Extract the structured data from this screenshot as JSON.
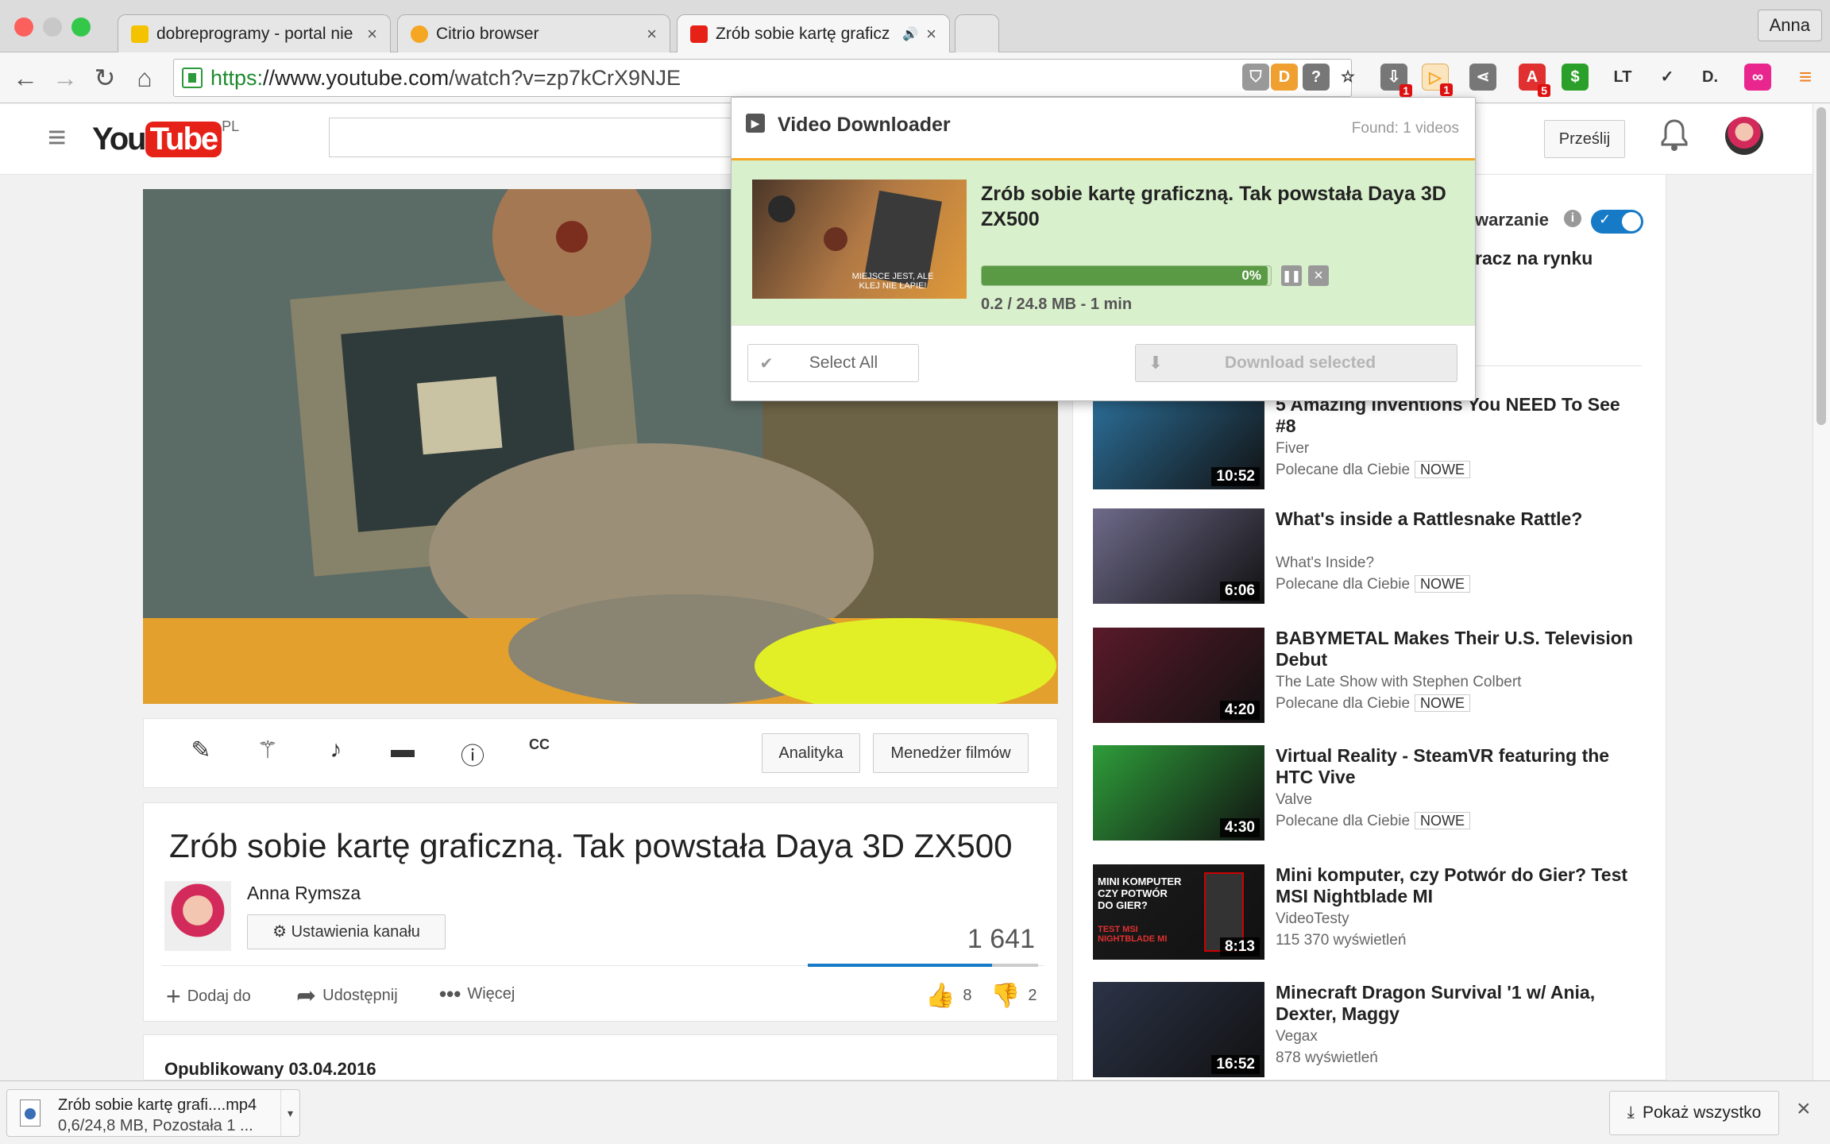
{
  "tabs": [
    {
      "title": "dobreprogramy - portal nie",
      "close": "×",
      "favicon_color": "#f5c200"
    },
    {
      "title": "Citrio browser",
      "close": "×",
      "favicon_color": "#f5a623"
    },
    {
      "title": "Zrób sobie kartę graficz",
      "close": "×",
      "favicon_color": "#e62117",
      "audio": "🔊"
    }
  ],
  "profile": "Anna",
  "toolbar": {
    "back": "←",
    "forward": "→",
    "reload": "↻",
    "home": "⌂",
    "url": {
      "scheme": "https:",
      "domain": "//www.youtube.com",
      "path": "/watch?v=zp7kCrX9NJE"
    }
  },
  "extensions": [
    {
      "name": "shield",
      "color": "#999",
      "glyph": "⛉"
    },
    {
      "name": "d-ext",
      "color": "#f0a030",
      "glyph": "D"
    },
    {
      "name": "help",
      "color": "#777",
      "glyph": "?"
    },
    {
      "name": "star",
      "color": "#fff",
      "glyph": "☆"
    },
    {
      "name": "downloads",
      "color": "#777",
      "glyph": "⇩",
      "badge": "1"
    },
    {
      "name": "video-downloader",
      "color": "#f5a623",
      "glyph": "▷",
      "badge": "1"
    },
    {
      "name": "share",
      "color": "#777",
      "glyph": "⋖"
    },
    {
      "name": "adblock",
      "color": "#e03030",
      "glyph": "A",
      "badge": "5"
    },
    {
      "name": "dollar",
      "color": "#2aa02a",
      "glyph": "$"
    },
    {
      "name": "lt",
      "color": "#fff",
      "glyph": "LT"
    },
    {
      "name": "abc",
      "color": "#fff",
      "glyph": "✓"
    },
    {
      "name": "d-dark",
      "color": "#fff",
      "glyph": "D."
    },
    {
      "name": "pink",
      "color": "#e9268e",
      "glyph": "∞"
    },
    {
      "name": "menu",
      "color": "#fff",
      "glyph": "≡"
    }
  ],
  "youtube": {
    "logo_you": "You",
    "logo_tube": "Tube",
    "region": "PL",
    "upload": "Prześlij",
    "menu": "≡",
    "bell": "🔔"
  },
  "editbar": {
    "analytics": "Analityka",
    "manager": "Menedżer filmów"
  },
  "video": {
    "title": "Zrób sobie kartę graficzną. Tak powstała Daya 3D ZX500",
    "channel": "Anna Rymsza",
    "channel_settings": "Ustawienia kanału",
    "views": "1 641",
    "add": "Dodaj do",
    "share": "Udostępnij",
    "more": "Więcej",
    "likes": "8",
    "dislikes": "2",
    "like_ratio": 0.8,
    "published": "Opublikowany 03.04.2016"
  },
  "sidebar": {
    "autoplay_label": "warzanie",
    "partial_title": "racz na rynku",
    "videos": [
      {
        "title": "5 Amazing Inventions You NEED To See #8",
        "channel": "Fiver",
        "meta": "Polecane dla Ciebie",
        "badge": "NOWE",
        "duration": "10:52",
        "color": "#2c6f99"
      },
      {
        "title": "What's inside a Rattlesnake Rattle?",
        "channel": "What's Inside?",
        "meta": "Polecane dla Ciebie",
        "badge": "NOWE",
        "duration": "6:06",
        "color": "#6e6a8a"
      },
      {
        "title": "BABYMETAL Makes Their U.S. Television Debut",
        "channel": "The Late Show with Stephen Colbert",
        "meta": "Polecane dla Ciebie",
        "badge": "NOWE",
        "duration": "4:20",
        "color": "#5a1a2a"
      },
      {
        "title": "Virtual Reality - SteamVR featuring the HTC Vive",
        "channel": "Valve",
        "meta": "Polecane dla Ciebie",
        "badge": "NOWE",
        "duration": "4:30",
        "color": "#2e9d3a"
      },
      {
        "title": "Mini komputer, czy Potwór do Gier? Test MSI Nightblade MI",
        "channel": "VideoTesty",
        "meta": "115 370 wyświetleń",
        "badge": "",
        "duration": "8:13",
        "color": "#1b1b1b",
        "thumb_text": "MINI KOMPUTER CZY POTWÓR DO GIER?",
        "thumb_sub": "TEST MSI NIGHTBLADE MI"
      },
      {
        "title": "Minecraft Dragon Survival '1 w/ Ania, Dexter, Maggy",
        "channel": "Vegax",
        "meta": "878 wyświetleń",
        "badge": "",
        "duration": "16:52",
        "color": "#2b3347"
      }
    ]
  },
  "downloader": {
    "header": "Video Downloader",
    "found": "Found: 1 videos",
    "item_title": "Zrób sobie kartę graficzną. Tak powstała Daya 3D ZX500",
    "progress_pct_label": "0%",
    "progress": 0.99,
    "size_info": "0.2 / 24.8 MB - 1 min",
    "thumb_caption": "MIEJSCE JEST, ALE KLEJ NIE ŁAPIE!",
    "select_all": "Select All",
    "download_selected": "Download selected"
  },
  "downloadbar": {
    "file": "Zrób sobie kartę grafi....mp4",
    "status": "0,6/24,8 MB, Pozostała 1 ...",
    "show_all": "Pokaż wszystko",
    "close": "×"
  }
}
